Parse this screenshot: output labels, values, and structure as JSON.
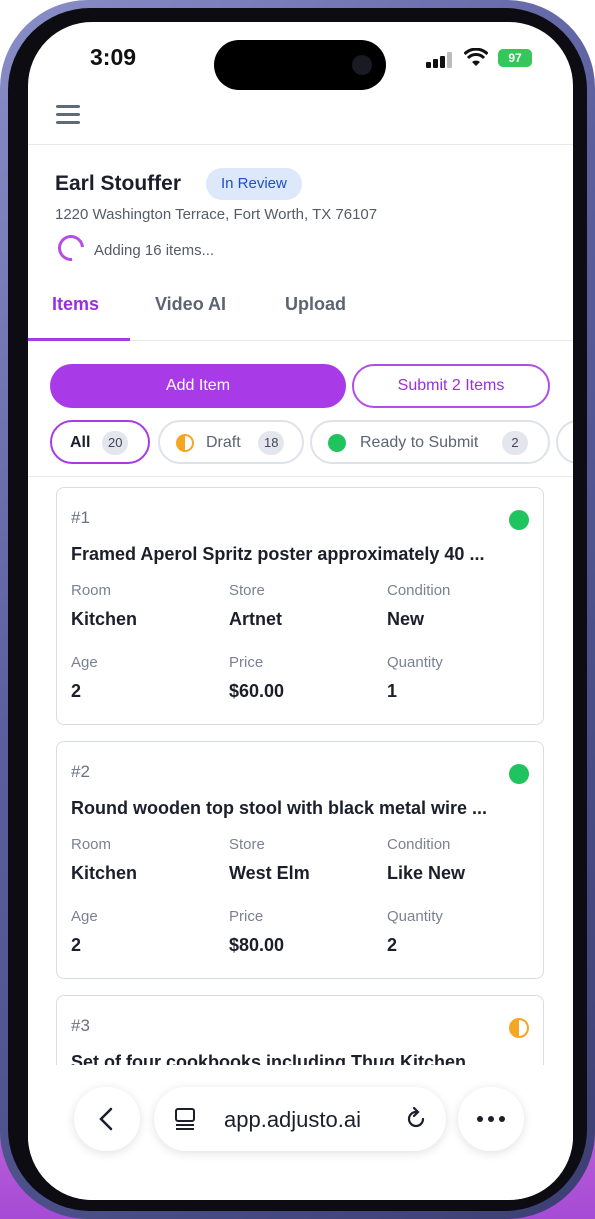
{
  "status_bar": {
    "time": "3:09",
    "battery": "97"
  },
  "header": {
    "menu_icon": "hamburger-icon"
  },
  "claim": {
    "name": "Earl Stouffer",
    "status": "In Review",
    "address": "1220 Washington Terrace, Fort Worth, TX 76107",
    "progress": "Adding 16 items..."
  },
  "tabs": [
    {
      "label": "Items",
      "active": true
    },
    {
      "label": "Video AI",
      "active": false
    },
    {
      "label": "Upload",
      "active": false
    }
  ],
  "actions": {
    "add_label": "Add Item",
    "submit_label": "Submit 2 Items"
  },
  "filters": [
    {
      "label": "All",
      "count": "20",
      "active": true
    },
    {
      "label": "Draft",
      "count": "18",
      "active": false
    },
    {
      "label": "Ready to Submit",
      "count": "2",
      "active": false
    }
  ],
  "field_labels": {
    "room": "Room",
    "store": "Store",
    "condition": "Condition",
    "age": "Age",
    "price": "Price",
    "quantity": "Quantity"
  },
  "items": [
    {
      "num": "#1",
      "status": "ready",
      "desc": "Framed Aperol Spritz poster approximately 40 ...",
      "room": "Kitchen",
      "store": "Artnet",
      "condition": "New",
      "age": "2",
      "price": "$60.00",
      "quantity": "1"
    },
    {
      "num": "#2",
      "status": "ready",
      "desc": "Round wooden top stool with black metal wire ...",
      "room": "Kitchen",
      "store": "West Elm",
      "condition": "Like New",
      "age": "2",
      "price": "$80.00",
      "quantity": "2"
    },
    {
      "num": "#3",
      "status": "draft",
      "desc": "Set of four cookbooks including Thug Kitchen ..."
    }
  ],
  "browser": {
    "url": "app.adjusto.ai"
  },
  "colors": {
    "accent": "#a93ae8",
    "ready": "#1fc45f",
    "draft": "#f5a623",
    "badge_bg": "#dde8fb"
  }
}
